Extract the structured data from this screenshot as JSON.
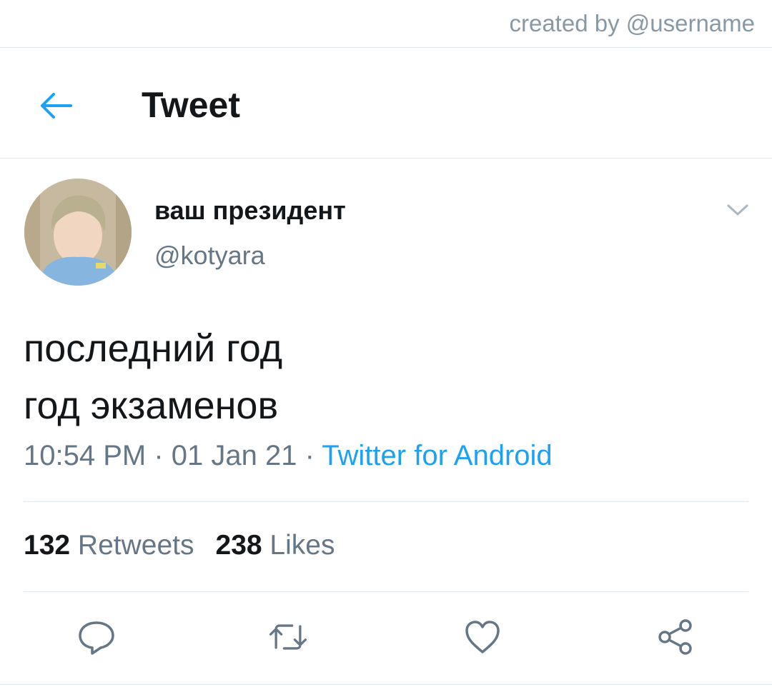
{
  "watermark": "created by @username",
  "header": {
    "title": "Tweet",
    "back_icon": "back-arrow-icon"
  },
  "tweet": {
    "display_name": "ваш президент",
    "handle": "@kotyara",
    "text_line1": "последний год",
    "text_line2": "год экзаменов",
    "time": "10:54 PM",
    "date": "01 Jan 21",
    "source": "Twitter for Android",
    "separator": " · "
  },
  "stats": {
    "retweets_count": "132",
    "retweets_label": "Retweets",
    "likes_count": "238",
    "likes_label": "Likes"
  },
  "actions": [
    "reply-icon",
    "retweet-icon",
    "like-icon",
    "share-icon"
  ],
  "colors": {
    "accent": "#1da1f2",
    "icon_gray": "#657786",
    "divider": "#e1e8ed",
    "text": "#14171a"
  }
}
